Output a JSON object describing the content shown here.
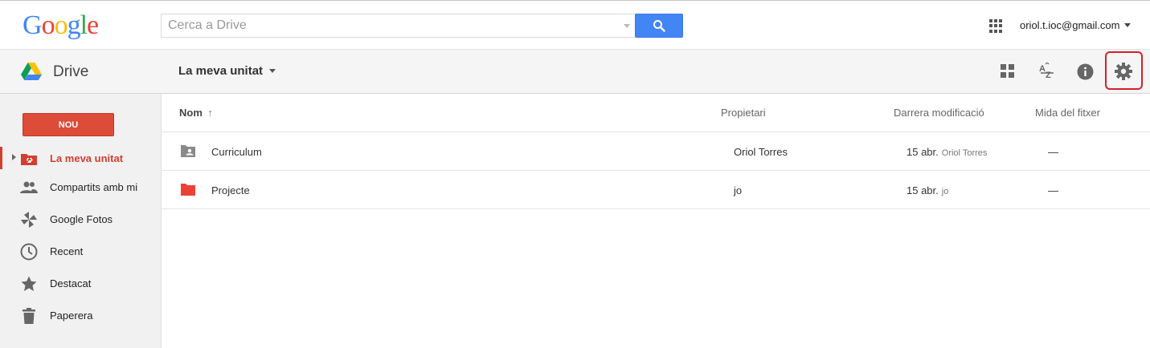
{
  "header": {
    "logo_letters": [
      {
        "ch": "G",
        "color": "#4285f4"
      },
      {
        "ch": "o",
        "color": "#ea4335"
      },
      {
        "ch": "o",
        "color": "#fbbc05"
      },
      {
        "ch": "g",
        "color": "#4285f4"
      },
      {
        "ch": "l",
        "color": "#34a853"
      },
      {
        "ch": "e",
        "color": "#ea4335"
      }
    ],
    "search_placeholder": "Cerca a Drive",
    "search_icon": "search-icon",
    "apps_icon": "apps-grid-icon",
    "account": "oriol.t.ioc@gmail.com"
  },
  "subbar": {
    "app_name": "Drive",
    "breadcrumb": "La meva unitat",
    "tools": [
      "grid-view-icon",
      "sort-az-icon",
      "info-icon",
      "settings-icon"
    ]
  },
  "sidebar": {
    "new_label": "NOU",
    "items": [
      {
        "label": "La meva unitat",
        "icon": "my-drive-icon",
        "active": true
      },
      {
        "label": "Compartits amb mi",
        "icon": "people-icon"
      },
      {
        "label": "Google Fotos",
        "icon": "photos-pinwheel-icon"
      },
      {
        "label": "Recent",
        "icon": "clock-icon"
      },
      {
        "label": "Destacat",
        "icon": "star-icon"
      },
      {
        "label": "Paperera",
        "icon": "trash-icon"
      }
    ]
  },
  "table": {
    "columns": {
      "name": "Nom",
      "sort_arrow": "↑",
      "owner": "Propietari",
      "modified": "Darrera modificació",
      "size": "Mida del fitxer"
    },
    "rows": [
      {
        "name": "Curriculum",
        "icon": "shared-folder-icon",
        "owner": "Oriol Torres",
        "modified": "15 abr.",
        "modified_by": "Oriol Torres",
        "size": "—"
      },
      {
        "name": "Projecte",
        "icon": "folder-icon",
        "owner": "jo",
        "modified": "15 abr.",
        "modified_by": "jo",
        "size": "—"
      }
    ]
  },
  "colors": {
    "accent_red": "#dd4b39",
    "search_blue": "#4285f4",
    "highlight_box": "#d3222a"
  }
}
